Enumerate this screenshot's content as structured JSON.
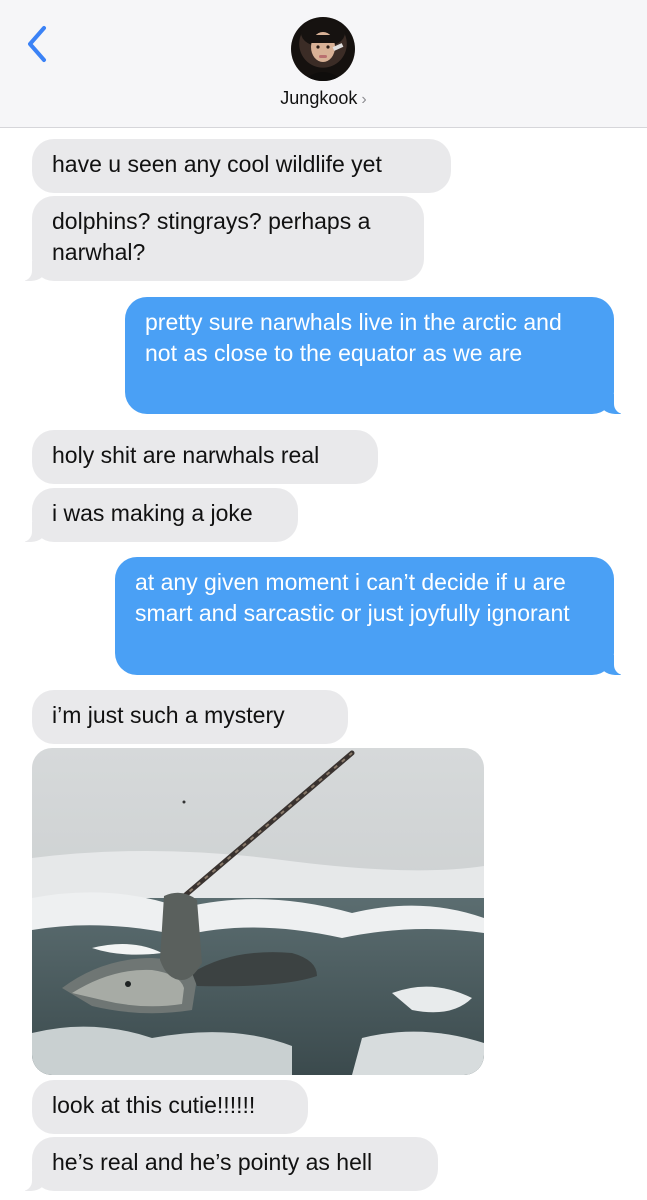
{
  "header": {
    "contact_name": "Jungkook",
    "chevron": "›",
    "back_icon": "chevron-left-icon"
  },
  "colors": {
    "outgoing_bubble": "#4aa0f5",
    "incoming_bubble": "#e9e9eb",
    "accent": "#3b82f6"
  },
  "messages": [
    {
      "from": "them",
      "text": "have u seen any cool wildlife yet"
    },
    {
      "from": "them",
      "text": "dolphins? stingrays? perhaps a narwhal?"
    },
    {
      "from": "me",
      "text": "pretty sure narwhals live in the arctic and not as close to the equator as we are"
    },
    {
      "from": "them",
      "text": "holy shit are narwhals real"
    },
    {
      "from": "them",
      "text": "i was making a joke"
    },
    {
      "from": "me",
      "text": "at any given moment i can’t decide if u are smart and sarcastic or just joyfully ignorant"
    },
    {
      "from": "them",
      "text": "i’m just such a mystery"
    },
    {
      "from": "them",
      "type": "image",
      "subject": "narwhal"
    },
    {
      "from": "them",
      "text": "look at this cutie!!!!!!"
    },
    {
      "from": "them",
      "text": "he’s real and he’s pointy as hell"
    }
  ]
}
